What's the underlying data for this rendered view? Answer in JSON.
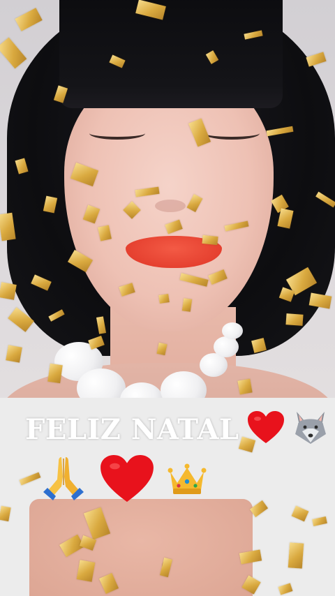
{
  "caption": {
    "text": "FELIZ NATAL"
  },
  "icons": {
    "caption_icons": [
      "heart-icon",
      "wolf-icon"
    ],
    "emoji_row": [
      "praying-hands-icon",
      "heart-icon",
      "crown-icon"
    ]
  },
  "colors": {
    "heart": "#e8121c",
    "caption_text": "#ffffff",
    "confetti_gold": "#d9a93f"
  }
}
